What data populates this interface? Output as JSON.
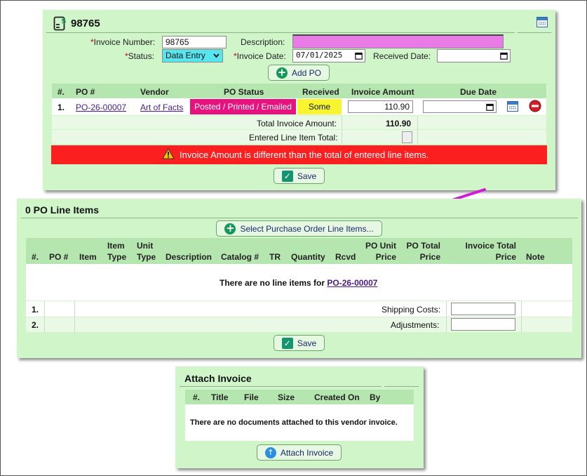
{
  "invoice": {
    "title": "98765",
    "labels": {
      "invoice_number": "Invoice Number:",
      "description": "Description:",
      "status": "Status:",
      "invoice_date": "Invoice Date:",
      "received_date": "Received Date:",
      "req": "*"
    },
    "invoice_number_value": "98765",
    "description_value": "",
    "status_value": "Data Entry",
    "invoice_date_value": "07/01/2025",
    "received_date_value": "",
    "add_po_label": "Add PO",
    "columns": [
      "#.",
      "PO #",
      "Vendor",
      "PO Status",
      "Received",
      "Invoice Amount",
      "Due Date"
    ],
    "row": {
      "num": "1.",
      "po": "PO-26-00007",
      "vendor": "Art of Facts",
      "status": "Posted / Printed / Emailed",
      "received": "Some",
      "amount": "110.90",
      "due": ""
    },
    "total_label": "Total Invoice Amount:",
    "total_value": "110.90",
    "entered_label": "Entered Line Item Total:",
    "warning": "Invoice Amount is different than the total of entered line items.",
    "save_label": "Save",
    "colors": {
      "panel": "#cff5c9",
      "status_badge": "#e8127f",
      "received_badge": "#f7f530",
      "warning": "#fb1f1f",
      "description_highlight": "#e87be6",
      "status_select": "#55e6f0"
    }
  },
  "line_items": {
    "title": "0 PO Line Items",
    "select_label": "Select Purchase Order Line Items...",
    "columns": [
      {
        "top": "",
        "bottom": "#."
      },
      {
        "top": "",
        "bottom": "PO #"
      },
      {
        "top": "",
        "bottom": "Item"
      },
      {
        "top": "Item",
        "bottom": "Type"
      },
      {
        "top": "Unit",
        "bottom": "Type"
      },
      {
        "top": "",
        "bottom": "Description"
      },
      {
        "top": "",
        "bottom": "Catalog #"
      },
      {
        "top": "",
        "bottom": "TR"
      },
      {
        "top": "",
        "bottom": "Quantity"
      },
      {
        "top": "",
        "bottom": "Rcvd"
      },
      {
        "top": "PO Unit",
        "bottom": "Price"
      },
      {
        "top": "PO Total",
        "bottom": "Price"
      },
      {
        "top": "Invoice Total",
        "bottom": "Price"
      },
      {
        "top": "",
        "bottom": "Note"
      }
    ],
    "empty_text": "There are no line items for",
    "empty_link": "PO-26-00007",
    "extra_rows": [
      {
        "num": "1.",
        "label": "Shipping Costs:",
        "value": ""
      },
      {
        "num": "2.",
        "label": "Adjustments:",
        "value": ""
      }
    ],
    "save_label": "Save",
    "arrow_color": "#d21bd6"
  },
  "attach": {
    "title": "Attach Invoice",
    "columns": [
      "#.",
      "Title",
      "File",
      "Size",
      "Created On",
      "By"
    ],
    "empty_text": "There are no documents attached to this vendor invoice.",
    "button_label": "Attach Invoice"
  }
}
